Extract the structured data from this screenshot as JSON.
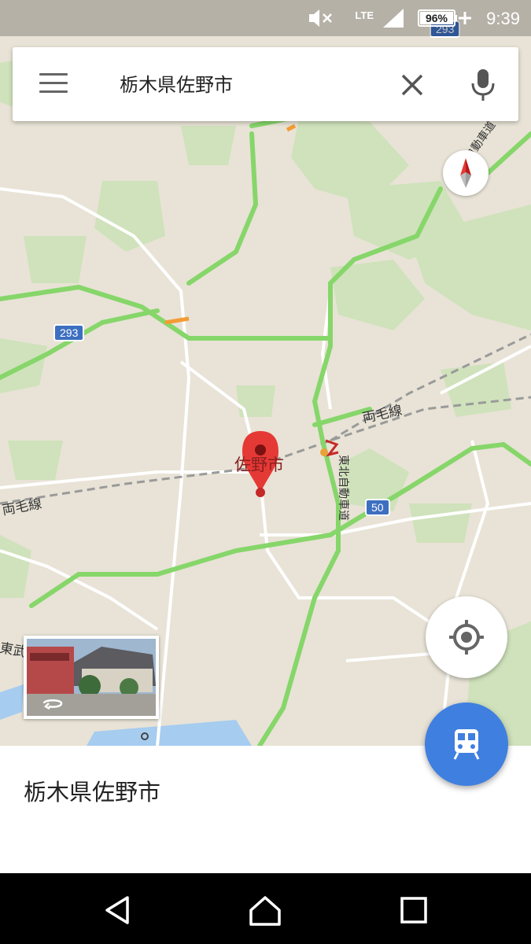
{
  "status_bar": {
    "time": "9:39",
    "battery": "96%",
    "network": "LTE",
    "icons": [
      "mute-icon",
      "signal-icon",
      "battery-icon"
    ]
  },
  "search": {
    "query": "栃木県佐野市",
    "menu_icon": "menu-icon",
    "clear_icon": "close-icon",
    "mic_icon": "mic-icon"
  },
  "map": {
    "city_label": "佐野市",
    "labels": {
      "ryomo_line_east": "両毛線",
      "ryomo_line_west": "両毛線",
      "tohoku_expressway": "東北自動車道",
      "tohoku_expressway_ne": "東北自動車道",
      "tobu": "東武"
    },
    "route_shields": {
      "r293_left": "293",
      "r293_top": "293",
      "r50": "50"
    },
    "colors": {
      "land": "#e8e3d6",
      "forest": "#c9dfb4",
      "highway": "#86d66a",
      "pin": "#e53935",
      "water": "#9ec7f0"
    }
  },
  "controls": {
    "compass_icon": "compass-icon",
    "locate_icon": "my-location-icon",
    "transit_icon": "train-icon",
    "streetview_icon": "street-view-rotate-icon",
    "fab_color": "#3f7fe0"
  },
  "bottom_sheet": {
    "title": "栃木県佐野市"
  },
  "nav_bar": {
    "icons": [
      "back-icon",
      "home-icon",
      "recents-icon"
    ]
  }
}
